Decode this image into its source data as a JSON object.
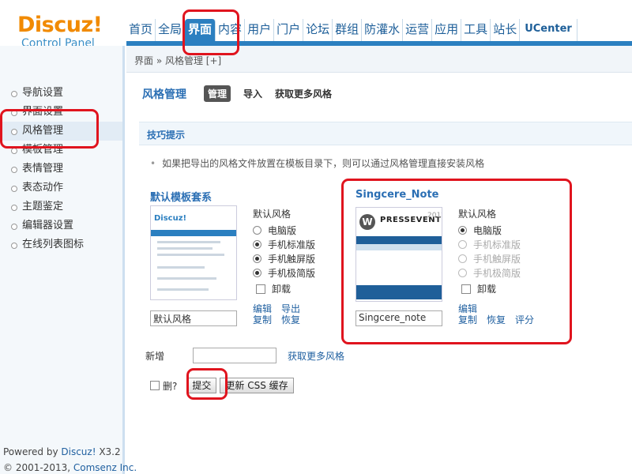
{
  "header": {
    "logo_brand": "Discuz!",
    "logo_sub": "Control Panel",
    "nav": [
      "首页",
      "全局",
      "界面",
      "内容",
      "用户",
      "门户",
      "论坛",
      "群组",
      "防灌水",
      "运营",
      "应用",
      "工具",
      "站长",
      "UCenter"
    ],
    "active_nav_index": 2
  },
  "breadcrumb": "界面 » 风格管理 [+]",
  "sidebar": {
    "items": [
      "导航设置",
      "界面设置",
      "风格管理",
      "模板管理",
      "表情管理",
      "表态动作",
      "主题鉴定",
      "编辑器设置",
      "在线列表图标"
    ],
    "active_index": 2,
    "footer_powered": "Powered by ",
    "footer_brand": "Discuz!",
    "footer_version": " X3.2",
    "footer_copy": "© 2001-2013, ",
    "footer_company": "Comsenz Inc."
  },
  "main": {
    "title": "风格管理",
    "tabs": [
      "管理",
      "导入",
      "获取更多风格"
    ],
    "tips_title": "技巧提示",
    "tip": "如果把导出的风格文件放置在模板目录下，则可以通过风格管理直接安装风格"
  },
  "themes": [
    {
      "title": "默认模板套系",
      "group_label": "默认风格",
      "options": [
        "电脑版",
        "手机标准版",
        "手机触屏版",
        "手机极简版"
      ],
      "checked": [
        false,
        true,
        true,
        true
      ],
      "uninstall": "卸载",
      "links_row1": [
        "编辑",
        "导出"
      ],
      "links_row2": [
        "复制",
        "恢复"
      ],
      "name_value": "默认风格",
      "thumb_text": "Discuz!"
    },
    {
      "title": "Singcere_Note",
      "group_label": "默认风格",
      "options": [
        "电脑版",
        "手机标准版",
        "手机触屏版",
        "手机极简版"
      ],
      "checked": [
        true,
        false,
        false,
        false
      ],
      "uninstall": "卸载",
      "links_row1": [
        "编辑"
      ],
      "links_row2": [
        "复制",
        "恢复",
        "评分"
      ],
      "name_value": "Singcere_note",
      "thumb_wp": "W",
      "thumb_brand": "PRESSEVENT",
      "thumb_year": "2012"
    }
  ],
  "form": {
    "add_label": "新增",
    "add_more": "获取更多风格",
    "delete_label": "删?",
    "submit": "提交",
    "update_css": "更新 CSS 缓存"
  },
  "colors": {
    "accent": "#2b7fc0",
    "logo_orange": "#f18a00",
    "annotation_red": "#e0141e"
  }
}
